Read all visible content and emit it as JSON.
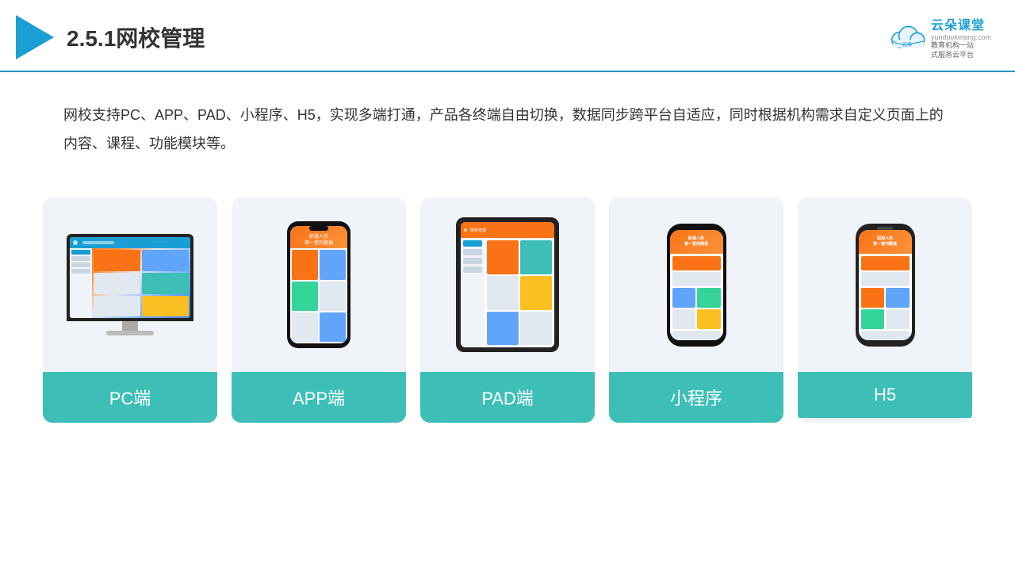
{
  "header": {
    "title": "2.5.1网校管理",
    "brand": {
      "name": "云朵课堂",
      "url": "yunduoketang.com",
      "tagline": "教育机构一站\n式服务云平台"
    }
  },
  "description": {
    "text": "网校支持PC、APP、PAD、小程序、H5，实现多端打通，产品各终端自由切换，数据同步跨平台自适应，同时根据机构需求自定义页面上的内容、课程、功能模块等。"
  },
  "cards": [
    {
      "id": "pc",
      "label": "PC端"
    },
    {
      "id": "app",
      "label": "APP端"
    },
    {
      "id": "pad",
      "label": "PAD端"
    },
    {
      "id": "miniapp",
      "label": "小程序"
    },
    {
      "id": "h5",
      "label": "H5"
    }
  ],
  "colors": {
    "accent": "#1a9fd4",
    "teal": "#3dbfb8",
    "orange": "#f97316"
  }
}
